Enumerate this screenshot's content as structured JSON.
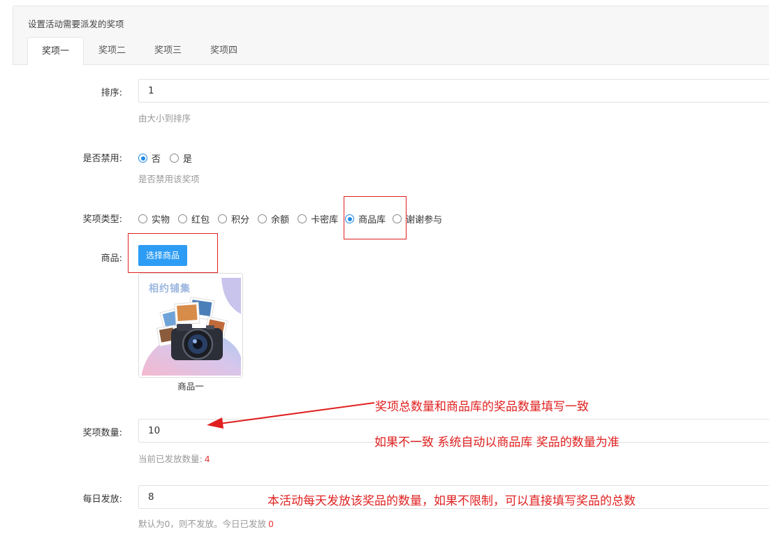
{
  "panel": {
    "title": "设置活动需要派发的奖项",
    "tabs": [
      "奖项一",
      "奖项二",
      "奖项三",
      "奖项四"
    ]
  },
  "form": {
    "sort": {
      "label": "排序:",
      "value": "1",
      "help": "由大小到排序"
    },
    "disabled": {
      "label": "是否禁用:",
      "options": [
        "否",
        "是"
      ],
      "selected": "否",
      "help": "是否禁用该奖项"
    },
    "prize_type": {
      "label": "奖项类型:",
      "options": [
        "实物",
        "红包",
        "积分",
        "余额",
        "卡密库",
        "商品库",
        "谢谢参与"
      ],
      "selected": "商品库"
    },
    "product": {
      "label": "商品:",
      "button": "选择商品",
      "thumb_logo": "相约铺集",
      "caption": "商品一"
    },
    "quantity": {
      "label": "奖项数量:",
      "value": "10",
      "help_prefix": "当前已发放数量:",
      "help_count": "4"
    },
    "daily": {
      "label": "每日发放:",
      "value": "8",
      "help_prefix": "默认为0，则不发放。今日已发放",
      "help_count": "0"
    }
  },
  "annotations": {
    "line1": "奖项总数量和商品库的奖品数量填写一致",
    "line2": "如果不一致 系统自动以商品库 奖品的数量为准",
    "line3": "本活动每天发放该奖品的数量，如果不限制，可以直接填写奖品的总数"
  },
  "colors": {
    "accent": "#2d9cf4",
    "annotation": "#e02020",
    "help_red": "#e4393c"
  }
}
